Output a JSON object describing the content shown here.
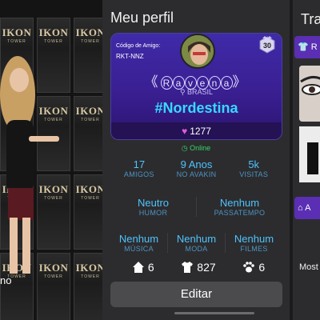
{
  "left": {
    "poster_brand": "IKON",
    "poster_sub": "TOWER",
    "caption": "no"
  },
  "profile": {
    "title": "Meu perfil",
    "friend_code_label": "Código de Amigo:",
    "friend_code": "RKT-NNZ",
    "level": "30",
    "name_letters": [
      "R",
      "a",
      "v",
      "e",
      "n",
      "a"
    ],
    "country": "BRASIL",
    "hashtag": "#Nordestina",
    "hearts": "1277",
    "status": "Online",
    "stats": {
      "friends_value": "17",
      "friends_label": "AMIGOS",
      "age_value": "9 Anos",
      "age_label": "NO AVAKIN",
      "visits_value": "5k",
      "visits_label": "VISITAS",
      "mood_value": "Neutro",
      "mood_label": "HUMOR",
      "hobby_value": "Nenhum",
      "hobby_label": "PASSATEMPO",
      "music_value": "Nenhum",
      "music_label": "MÚSICA",
      "fashion_value": "Nenhum",
      "fashion_label": "MODA",
      "movies_value": "Nenhum",
      "movies_label": "FILMES"
    },
    "counts": {
      "homes": "6",
      "outfits": "827",
      "pets": "6"
    },
    "edit_label": "Editar"
  },
  "right": {
    "title": "Tra",
    "tab1": "R",
    "tab2": "A",
    "caption": "Most"
  },
  "colors": {
    "card_purple": "#3f2aa8",
    "hashtag": "#36d9ff",
    "stat_value": "#4fc3ff",
    "online": "#37d46a",
    "tab_purple": "#5a2fb4"
  }
}
